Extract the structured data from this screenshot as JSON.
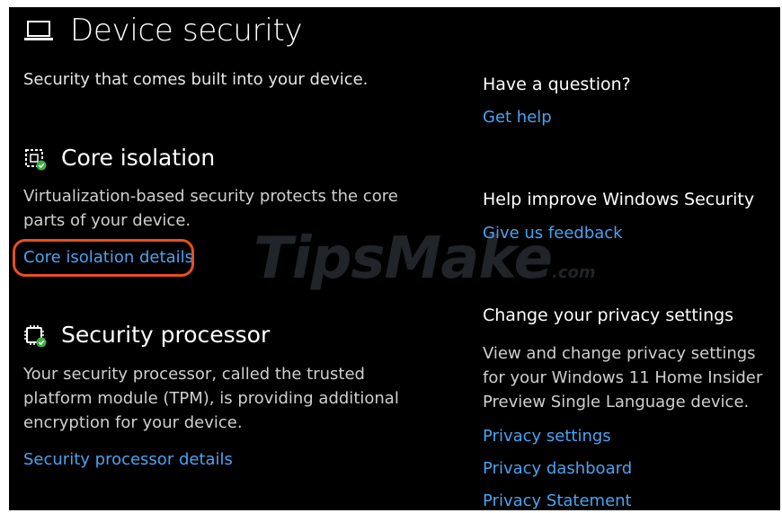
{
  "header": {
    "title": "Device security",
    "icon": "laptop-icon",
    "subtitle": "Security that comes built into your device."
  },
  "core_isolation": {
    "icon": "core-isolation-chip-icon",
    "title": "Core isolation",
    "description": "Virtualization-based security protects the core parts of your device.",
    "link": "Core isolation details"
  },
  "security_processor": {
    "icon": "processor-chip-icon",
    "title": "Security processor",
    "description": "Your security processor, called the trusted platform module (TPM), is providing additional encryption for your device.",
    "link": "Security processor details"
  },
  "sidebar": {
    "question": {
      "heading": "Have a question?",
      "link": "Get help"
    },
    "improve": {
      "heading": "Help improve Windows Security",
      "link": "Give us feedback"
    },
    "privacy": {
      "heading": "Change your privacy settings",
      "description": "View and change privacy settings for your Windows 11 Home Insider Preview Single Language device.",
      "links": [
        "Privacy settings",
        "Privacy dashboard",
        "Privacy Statement"
      ]
    }
  },
  "watermark": {
    "text": "TipsMake",
    "suffix": ".com"
  },
  "colors": {
    "background": "#000000",
    "text": "#ffffff",
    "link": "#4aa3f0",
    "highlight": "#e8501e",
    "check_badge": "#3cb043"
  }
}
